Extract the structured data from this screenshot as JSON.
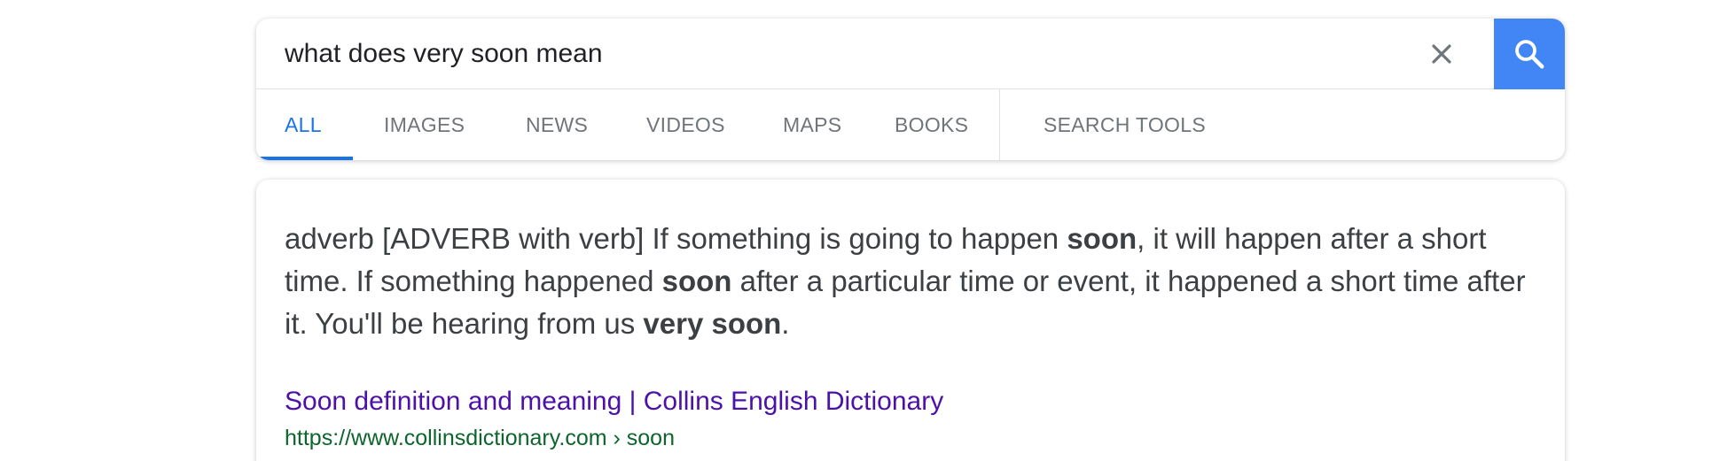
{
  "search": {
    "query": "what does very soon mean",
    "clear_icon": "close-icon",
    "search_icon": "search-icon"
  },
  "tabs": [
    {
      "label": "ALL",
      "active": true
    },
    {
      "label": "IMAGES",
      "active": false
    },
    {
      "label": "NEWS",
      "active": false
    },
    {
      "label": "VIDEOS",
      "active": false
    },
    {
      "label": "MAPS",
      "active": false
    },
    {
      "label": "BOOKS",
      "active": false
    },
    {
      "label": "SEARCH TOOLS",
      "active": false
    }
  ],
  "result": {
    "snippet": {
      "p1": "adverb [ADVERB with verb] If something is going to happen ",
      "b1": "soon",
      "p2": ", it will happen after a short time. If something happened ",
      "b2": "soon",
      "p3": " after a particular time or event, it happened a short time after it. You'll be hearing from us ",
      "b3": "very soon",
      "p4": "."
    },
    "title": "Soon definition and meaning | Collins English Dictionary",
    "url": "https://www.collinsdictionary.com › soon"
  },
  "colors": {
    "accent": "#1a73e8",
    "search_button": "#4285f4",
    "visited_link": "#4b11a8",
    "url_green": "#0d652d"
  }
}
